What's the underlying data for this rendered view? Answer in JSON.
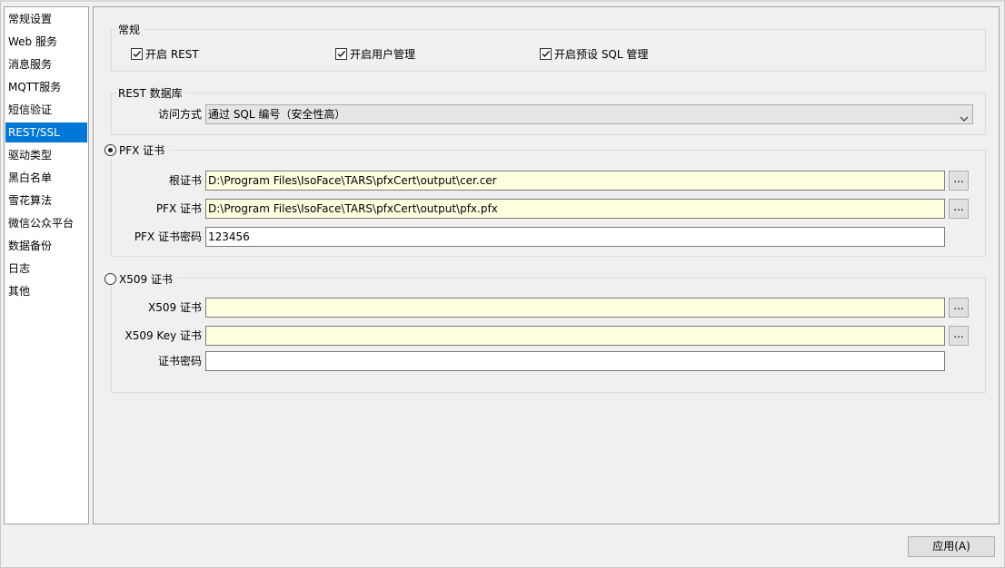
{
  "sidebar": {
    "items": [
      {
        "label": "常规设置"
      },
      {
        "label": "Web 服务"
      },
      {
        "label": "消息服务"
      },
      {
        "label": "MQTT服务"
      },
      {
        "label": "短信验证"
      },
      {
        "label": "REST/SSL",
        "selected": true
      },
      {
        "label": "驱动类型"
      },
      {
        "label": "黑白名单"
      },
      {
        "label": "雪花算法"
      },
      {
        "label": "微信公众平台"
      },
      {
        "label": "数据备份"
      },
      {
        "label": "日志"
      },
      {
        "label": "其他"
      }
    ]
  },
  "general": {
    "title": "常规",
    "enable_rest": {
      "label": "开启 REST",
      "checked": true
    },
    "enable_user_mgmt": {
      "label": "开启用户管理",
      "checked": true
    },
    "enable_sql_mgmt": {
      "label": "开启预设 SQL 管理",
      "checked": true
    }
  },
  "rest_db": {
    "title": "REST 数据库",
    "access_label": "访问方式",
    "access_value": "通过 SQL 编号（安全性高）"
  },
  "pfx": {
    "title": "PFX 证书",
    "selected": true,
    "root_label": "根证书",
    "root_value": "D:\\Program Files\\IsoFace\\TARS\\pfxCert\\output\\cer.cer",
    "pfx_label": "PFX 证书",
    "pfx_value": "D:\\Program Files\\IsoFace\\TARS\\pfxCert\\output\\pfx.pfx",
    "password_label": "PFX 证书密码",
    "password_value": "123456"
  },
  "x509": {
    "title": "X509 证书",
    "selected": false,
    "cert_label": "X509 证书",
    "cert_value": "",
    "key_label": "X509 Key 证书",
    "key_value": "",
    "password_label": "证书密码",
    "password_value": ""
  },
  "browse_label": "...",
  "apply_label": "应用(A)",
  "colors": {
    "selection": "#0078d7",
    "file_field": "#ffffe1"
  }
}
